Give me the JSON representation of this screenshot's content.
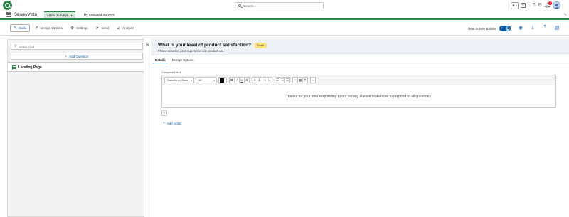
{
  "header": {
    "search_placeholder": "Search...",
    "notification_count": "1"
  },
  "nav": {
    "app_name": "SurveyVista",
    "tabs": [
      {
        "label": "Active Surveys"
      },
      {
        "label": "My Assigned Surveys"
      }
    ]
  },
  "toolbar": {
    "items": [
      {
        "label": "Build",
        "icon": "wrench-icon"
      },
      {
        "label": "Design Options",
        "icon": "brush-icon"
      },
      {
        "label": "Settings",
        "icon": "gear-icon"
      },
      {
        "label": "Send",
        "icon": "send-icon"
      },
      {
        "label": "Analyze",
        "icon": "chart-icon"
      }
    ],
    "builder_toggle_label": "New Survey Builder",
    "builder_toggle_on": true
  },
  "left_panel": {
    "quick_find_placeholder": "Quick Find",
    "add_question_label": "Add Question",
    "pages": [
      {
        "label": "Landing Page"
      }
    ]
  },
  "page": {
    "title": "What is your level of product satisfaction?",
    "status": "Draft",
    "description": "Please describe your experience with product use.",
    "tabs": [
      {
        "label": "Details"
      },
      {
        "label": "Design Options"
      }
    ]
  },
  "editor": {
    "field_label": "Composed text",
    "font_family": "Salesforce Sans",
    "font_size": "12",
    "text_color": "#000000",
    "content": "Thanks for your time responding to our survey. Please make sure to respond to all questions."
  },
  "footer": {
    "add_footer_label": "Add footer"
  },
  "colors": {
    "brand_green": "#2e844a",
    "accent_blue": "#0b5cab",
    "draft_badge": "#fbe17a"
  }
}
